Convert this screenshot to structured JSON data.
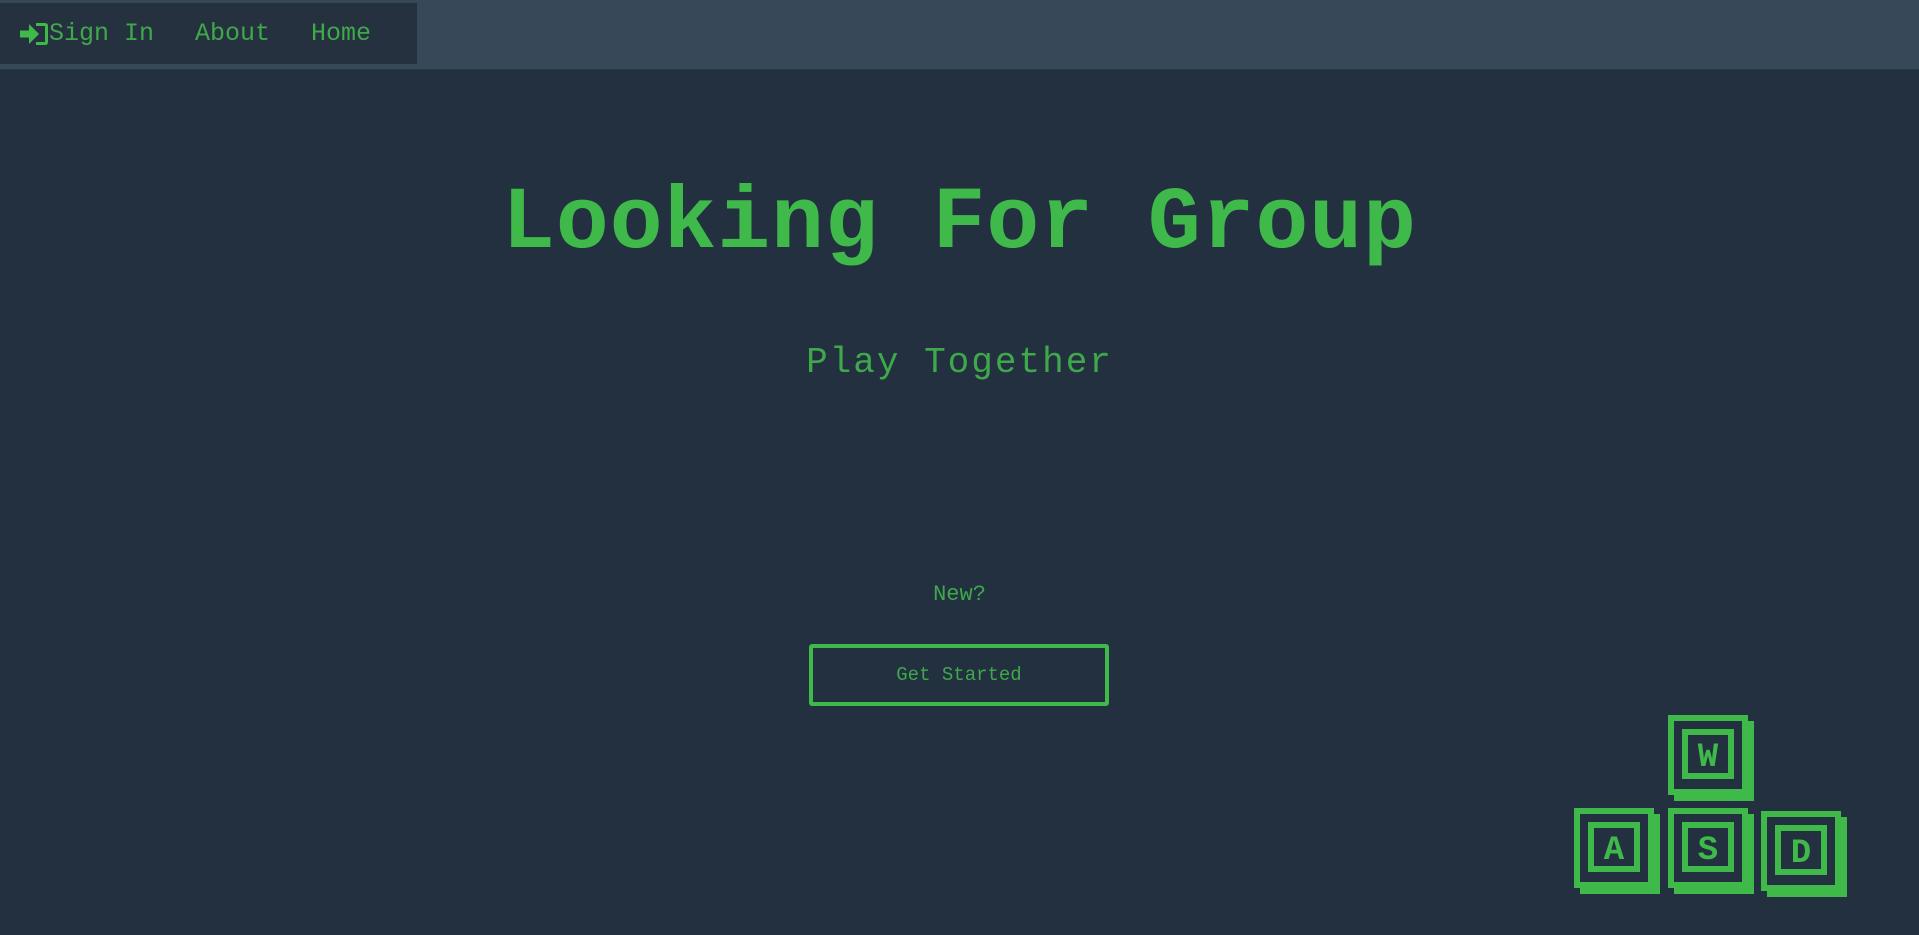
{
  "nav": {
    "signin_label": "Sign In",
    "about_label": "About",
    "home_label": "Home"
  },
  "hero": {
    "title": "Looking For Group",
    "subtitle": "Play Together"
  },
  "cta": {
    "prompt": "New?",
    "button_label": "Get Started"
  },
  "graphic": {
    "keys": [
      "W",
      "A",
      "S",
      "D"
    ]
  },
  "colors": {
    "background": "#223040",
    "topbar": "#374859",
    "accent": "#3fb94a"
  },
  "icons": {
    "signin": "sign-in-arrow-icon",
    "keys": "wasd-keys-icon"
  }
}
